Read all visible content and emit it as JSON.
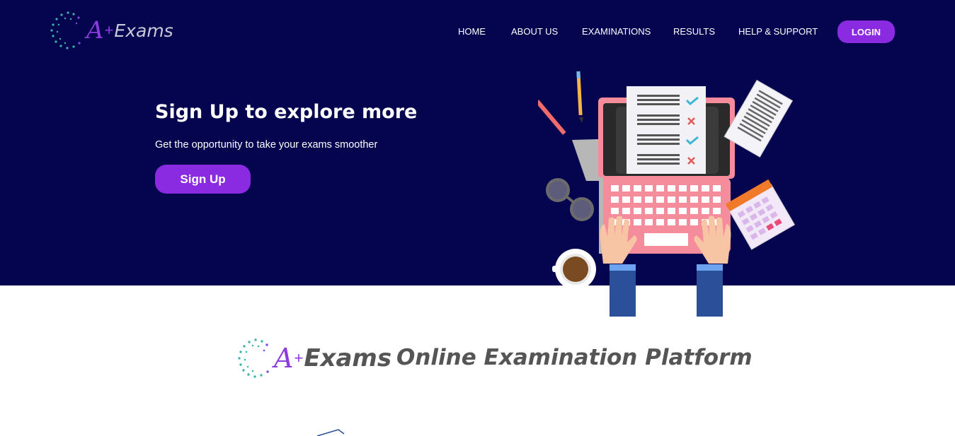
{
  "brand": {
    "logo_letter": "A",
    "logo_plus": "+",
    "logo_word": "Exams",
    "tagline": "Online Examination Platform",
    "colors": {
      "navy": "#04044f",
      "purple": "#8a2be2",
      "dots_teal": "#3fb7a8",
      "dots_purple": "#7b4fd6"
    }
  },
  "nav": {
    "items": [
      {
        "label": "HOME"
      },
      {
        "label": "ABOUT US"
      },
      {
        "label": "EXAMINATIONS"
      },
      {
        "label": "RESULTS"
      },
      {
        "label": "HELP & SUPPORT"
      }
    ],
    "login_label": "LOGIN"
  },
  "hero": {
    "title": "Sign Up to explore more",
    "subtitle": "Get the opportunity to take your exams smoother",
    "signup_label": "Sign Up",
    "illustration_icon": "laptop-exam-illustration"
  }
}
